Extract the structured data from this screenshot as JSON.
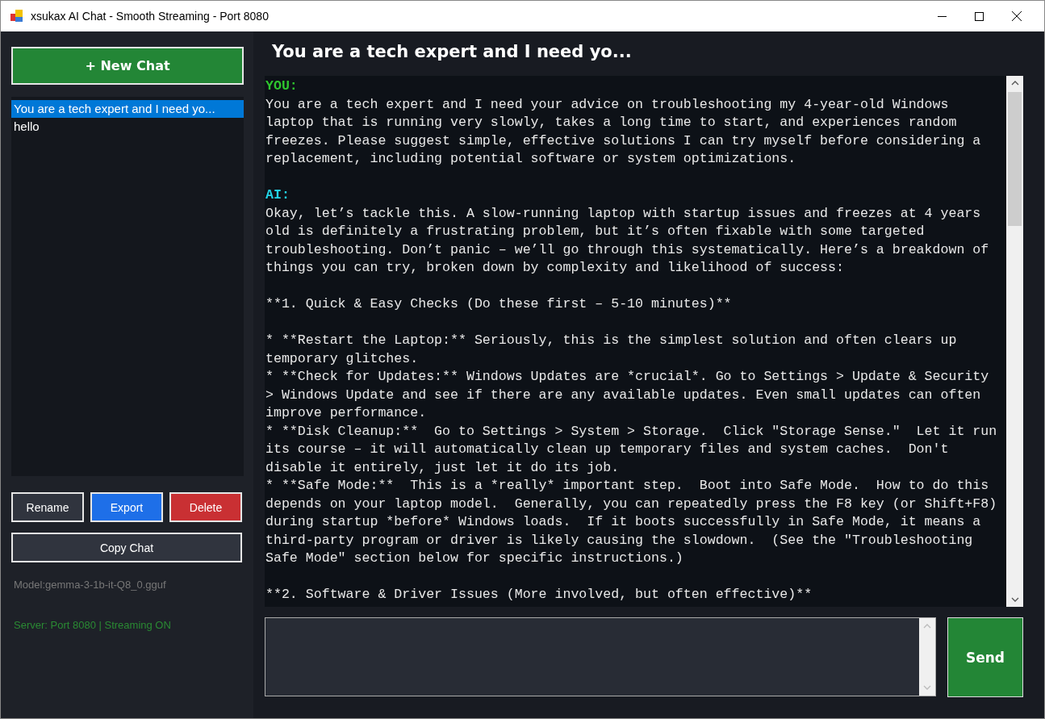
{
  "window": {
    "title": "xsukax AI Chat - Smooth Streaming - Port 8080"
  },
  "sidebar": {
    "new_chat_button": "+ New Chat",
    "chats": [
      {
        "label": "You are a tech expert and I need yo...",
        "selected": true
      },
      {
        "label": "hello",
        "selected": false
      }
    ],
    "buttons": [
      {
        "label": "Rename",
        "kind": "neutral"
      },
      {
        "label": "Export",
        "kind": "primary"
      },
      {
        "label": "Delete",
        "kind": "danger"
      }
    ],
    "copy_button": "Copy Chat",
    "model": "Model:gemma-3-1b-it-Q8_0.gguf",
    "server_status": "Server: Port 8080 | Streaming ON"
  },
  "chat": {
    "title": "You are a tech expert and I need yo...",
    "transcript": [
      {
        "kind": "speaker",
        "color": "#2ec52e",
        "text": "YOU:"
      },
      {
        "kind": "line",
        "text": "You are a tech expert and I need your advice on troubleshooting my 4-year-old Windows"
      },
      {
        "kind": "line",
        "text": "laptop that is running very slowly, takes a long time to start, and experiences random"
      },
      {
        "kind": "line",
        "text": "freezes. Please suggest simple, effective solutions I can try myself before considering a"
      },
      {
        "kind": "line",
        "text": "replacement, including potential software or system optimizations."
      },
      {
        "kind": "blank"
      },
      {
        "kind": "speaker",
        "color": "#22d3e6",
        "text": "AI:"
      },
      {
        "kind": "line",
        "text": "Okay, let’s tackle this. A slow-running laptop with startup issues and freezes at 4 years"
      },
      {
        "kind": "line",
        "text": "old is definitely a frustrating problem, but it’s often fixable with some targeted"
      },
      {
        "kind": "line",
        "text": "troubleshooting. Don’t panic – we’ll go through this systematically. Here’s a breakdown of"
      },
      {
        "kind": "line",
        "text": "things you can try, broken down by complexity and likelihood of success:"
      },
      {
        "kind": "blank"
      },
      {
        "kind": "line",
        "text": "**1. Quick & Easy Checks (Do these first – 5-10 minutes)**"
      },
      {
        "kind": "blank"
      },
      {
        "kind": "line",
        "text": "* **Restart the Laptop:** Seriously, this is the simplest solution and often clears up"
      },
      {
        "kind": "line",
        "text": "temporary glitches."
      },
      {
        "kind": "line",
        "text": "* **Check for Updates:** Windows Updates are *crucial*. Go to Settings > Update & Security"
      },
      {
        "kind": "line",
        "text": "> Windows Update and see if there are any available updates. Even small updates can often"
      },
      {
        "kind": "line",
        "text": "improve performance."
      },
      {
        "kind": "line",
        "text": "* **Disk Cleanup:**  Go to Settings > System > Storage.  Click \"Storage Sense.\"  Let it run"
      },
      {
        "kind": "line",
        "text": "its course – it will automatically clean up temporary files and system caches.  Don't"
      },
      {
        "kind": "line",
        "text": "disable it entirely, just let it do its job."
      },
      {
        "kind": "line",
        "text": "* **Safe Mode:**  This is a *really* important step.  Boot into Safe Mode.  How to do this"
      },
      {
        "kind": "line",
        "text": "depends on your laptop model.  Generally, you can repeatedly press the F8 key (or Shift+F8)"
      },
      {
        "kind": "line",
        "text": "during startup *before* Windows loads.  If it boots successfully in Safe Mode, it means a"
      },
      {
        "kind": "line",
        "text": "third-party program or driver is likely causing the slowdown.  (See the \"Troubleshooting"
      },
      {
        "kind": "line",
        "text": "Safe Mode\" section below for specific instructions.)"
      },
      {
        "kind": "blank"
      },
      {
        "kind": "line",
        "text": "**2. Software & Driver Issues (More involved, but often effective)**"
      }
    ],
    "send_button": "Send"
  }
}
